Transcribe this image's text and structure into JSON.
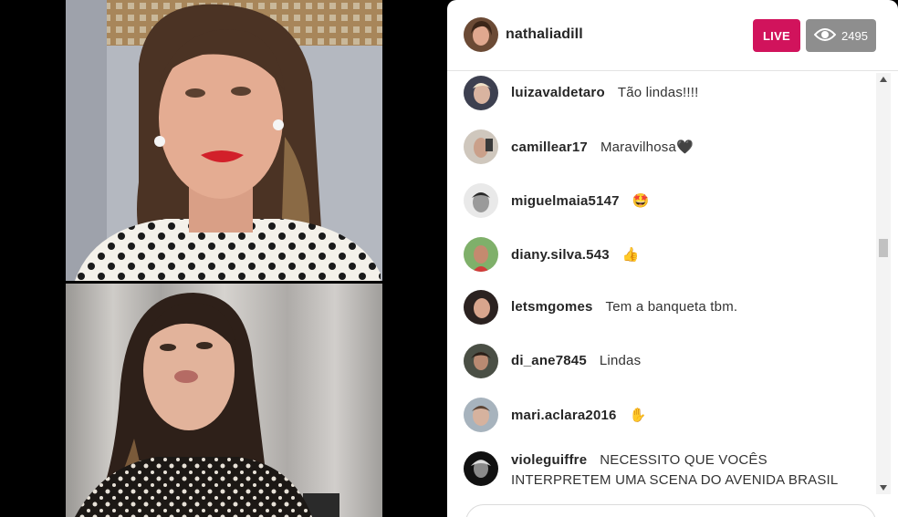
{
  "header": {
    "host_username": "nathaliadill",
    "live_label": "LIVE",
    "viewer_count": "2495"
  },
  "comments": [
    {
      "username": "luizavaldetaro",
      "message": "Tão lindas!!!!"
    },
    {
      "username": "camillear17",
      "message": "Maravilhosa🖤"
    },
    {
      "username": "miguelmaia5147",
      "message": "🤩"
    },
    {
      "username": "diany.silva.543",
      "message": "👍"
    },
    {
      "username": "letsmgomes",
      "message": "Tem a banqueta tbm."
    },
    {
      "username": "di_ane7845",
      "message": "Lindas"
    },
    {
      "username": "mari.aclara2016",
      "message": "✋"
    },
    {
      "username": "violeguiffre",
      "message": "NECESSITO QUE VOCÊS INTERPRETEM UMA SCENA DO AVENIDA BRASIL"
    }
  ],
  "colors": {
    "live_badge": "#d1135c",
    "viewer_badge": "#8e8e8e",
    "panel_bg": "#ffffff",
    "video_bg": "#000000"
  },
  "icons": {
    "viewer": "eye-icon",
    "scroll_up": "chevron-up-icon",
    "scroll_down": "chevron-down-icon"
  }
}
